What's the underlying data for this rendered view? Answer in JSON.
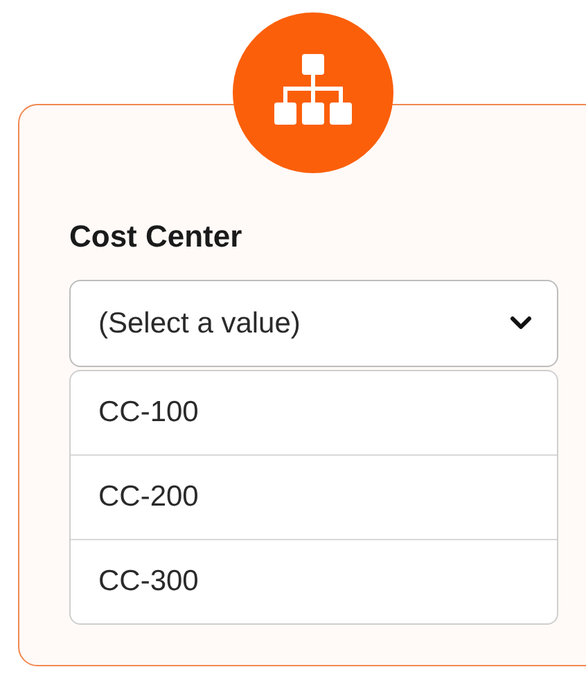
{
  "field": {
    "label": "Cost Center",
    "placeholder": "(Select a value)",
    "expanded": true
  },
  "options": [
    {
      "label": "CC-100",
      "selected": false
    },
    {
      "label": "CC-200",
      "selected": false
    },
    {
      "label": "CC-300",
      "selected": false
    }
  ]
}
